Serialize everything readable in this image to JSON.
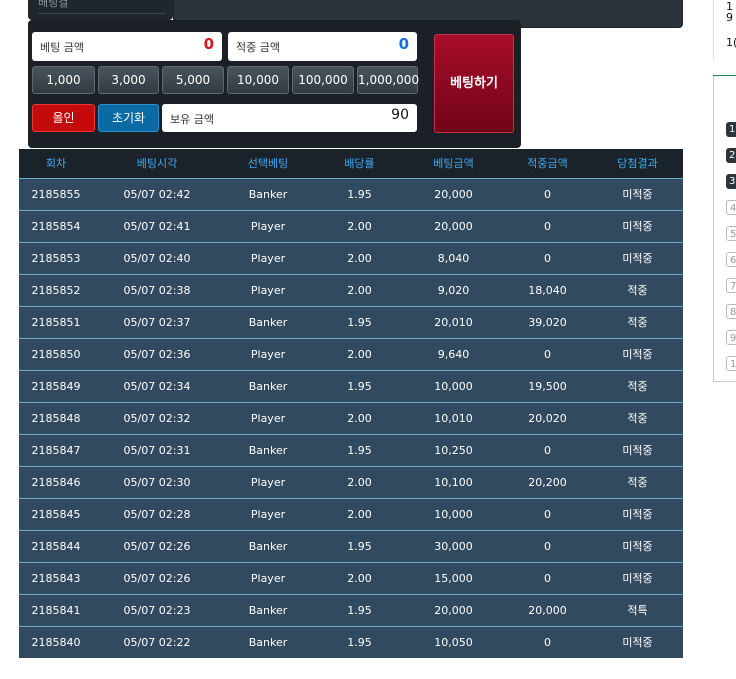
{
  "top": {
    "cut_label": "배팅결"
  },
  "bet_panel": {
    "bet_amount_label": "베팅 금액",
    "bet_amount_value": "0",
    "win_amount_label": "적중 금액",
    "win_amount_value": "0",
    "chips": [
      "1,000",
      "3,000",
      "5,000",
      "10,000",
      "100,000",
      "1,000,000"
    ],
    "all_in_label": "올인",
    "reset_label": "초기화",
    "balance_label": "보유 금액",
    "balance_value": "90",
    "bet_button_label": "베팅하기"
  },
  "table": {
    "headers": [
      "회차",
      "베팅시각",
      "선택베팅",
      "배당률",
      "베팅금액",
      "적중금액",
      "당첨결과"
    ],
    "rows": [
      [
        "2185855",
        "05/07 02:42",
        "Banker",
        "1.95",
        "20,000",
        "0",
        "미적중"
      ],
      [
        "2185854",
        "05/07 02:41",
        "Player",
        "2.00",
        "20,000",
        "0",
        "미적중"
      ],
      [
        "2185853",
        "05/07 02:40",
        "Player",
        "2.00",
        "8,040",
        "0",
        "미적중"
      ],
      [
        "2185852",
        "05/07 02:38",
        "Player",
        "2.00",
        "9,020",
        "18,040",
        "적중"
      ],
      [
        "2185851",
        "05/07 02:37",
        "Banker",
        "1.95",
        "20,010",
        "39,020",
        "적중"
      ],
      [
        "2185850",
        "05/07 02:36",
        "Player",
        "2.00",
        "9,640",
        "0",
        "미적중"
      ],
      [
        "2185849",
        "05/07 02:34",
        "Banker",
        "1.95",
        "10,000",
        "19,500",
        "적중"
      ],
      [
        "2185848",
        "05/07 02:32",
        "Player",
        "2.00",
        "10,010",
        "20,020",
        "적중"
      ],
      [
        "2185847",
        "05/07 02:31",
        "Banker",
        "1.95",
        "10,250",
        "0",
        "미적중"
      ],
      [
        "2185846",
        "05/07 02:30",
        "Player",
        "2.00",
        "10,100",
        "20,200",
        "적중"
      ],
      [
        "2185845",
        "05/07 02:28",
        "Player",
        "2.00",
        "10,000",
        "0",
        "미적중"
      ],
      [
        "2185844",
        "05/07 02:26",
        "Banker",
        "1.95",
        "30,000",
        "0",
        "미적중"
      ],
      [
        "2185843",
        "05/07 02:26",
        "Player",
        "2.00",
        "15,000",
        "0",
        "미적중"
      ],
      [
        "2185841",
        "05/07 02:23",
        "Banker",
        "1.95",
        "20,000",
        "20,000",
        "적특"
      ],
      [
        "2185840",
        "05/07 02:22",
        "Banker",
        "1.95",
        "10,050",
        "0",
        "미적중"
      ]
    ]
  },
  "right_panel": {
    "texts": [
      "1",
      "9",
      "1("
    ],
    "ranks": [
      "1",
      "2",
      "3",
      "4",
      "5",
      "6",
      "7",
      "8",
      "9",
      "10"
    ]
  },
  "colors": {
    "loss": "#e0271f",
    "win": "#f0b030",
    "header_text": "#40a8f0",
    "row_bg": "#324a5f"
  }
}
